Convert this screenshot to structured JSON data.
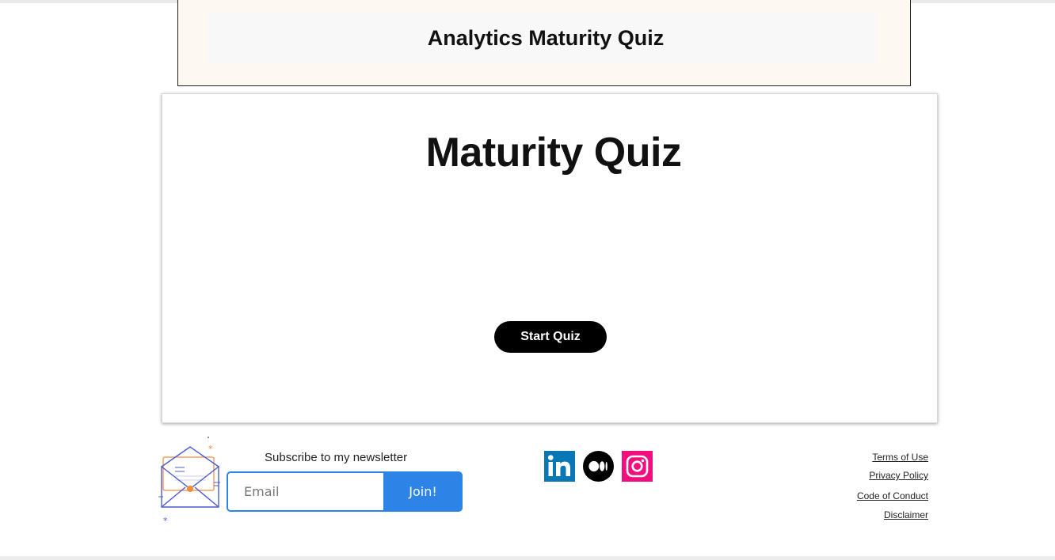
{
  "header": {
    "title": "Analytics Maturity Quiz"
  },
  "quiz": {
    "title": "Maturity Quiz",
    "start_label": "Start Quiz"
  },
  "newsletter": {
    "heading": "Subscribe to my newsletter",
    "email_placeholder": "Email",
    "join_label": "Join!"
  },
  "social": {
    "items": [
      "linkedin-icon",
      "medium-icon",
      "instagram-icon"
    ]
  },
  "legal": {
    "terms": "Terms of Use",
    "privacy": "Privacy Policy",
    "conduct": "Code of Conduct",
    "disclaimer": "Disclaimer"
  },
  "colors": {
    "accent": "#2d83e6",
    "linkedin": "#0a77b5",
    "instagram": "#f20e7f",
    "envelope_stroke": "#4a5ccf",
    "envelope_accent": "#f08a3c"
  }
}
